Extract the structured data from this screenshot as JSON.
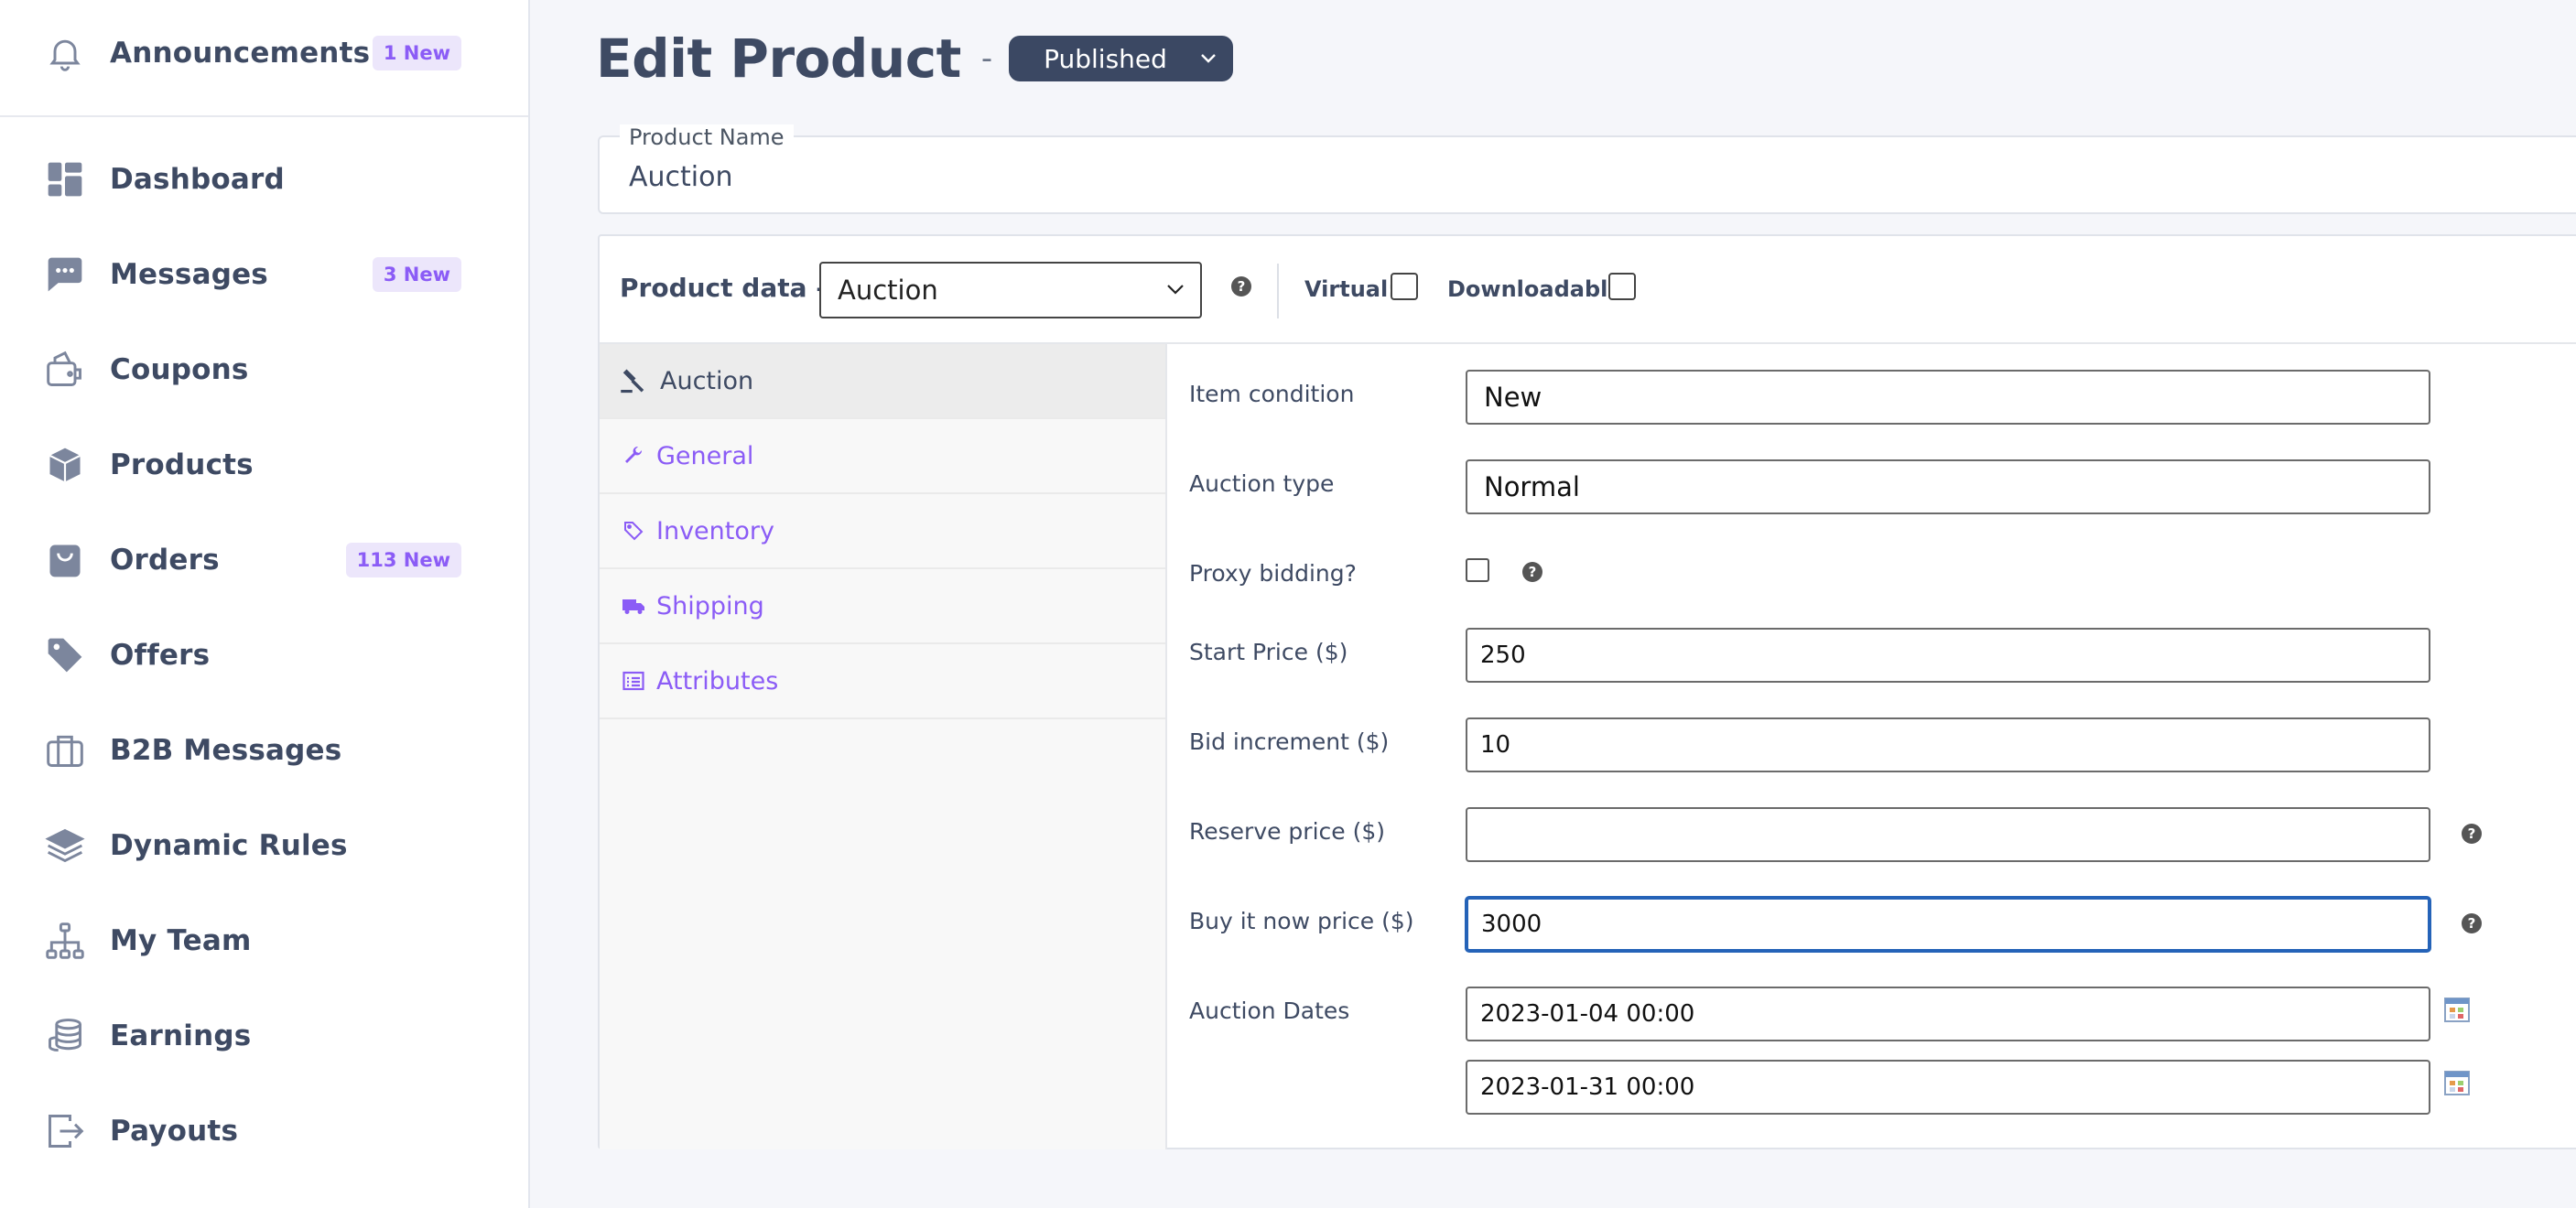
{
  "sidebar": {
    "items": [
      {
        "label": "Announcements",
        "badge": "1 New",
        "icon": "bell-icon"
      },
      {
        "label": "Dashboard",
        "badge": "",
        "icon": "dashboard-icon"
      },
      {
        "label": "Messages",
        "badge": "3 New",
        "icon": "chat-icon"
      },
      {
        "label": "Coupons",
        "badge": "",
        "icon": "coupon-icon"
      },
      {
        "label": "Products",
        "badge": "",
        "icon": "box-icon"
      },
      {
        "label": "Orders",
        "badge": "113 New",
        "icon": "bag-icon"
      },
      {
        "label": "Offers",
        "badge": "",
        "icon": "tag-icon"
      },
      {
        "label": "B2B Messages",
        "badge": "",
        "icon": "briefcase-icon"
      },
      {
        "label": "Dynamic Rules",
        "badge": "",
        "icon": "layers-icon"
      },
      {
        "label": "My Team",
        "badge": "",
        "icon": "org-chart-icon"
      },
      {
        "label": "Earnings",
        "badge": "",
        "icon": "coins-icon"
      },
      {
        "label": "Payouts",
        "badge": "",
        "icon": "logout-icon"
      }
    ]
  },
  "header": {
    "title": "Edit Product",
    "separator": "-",
    "status": "Published"
  },
  "product_name": {
    "legend": "Product Name",
    "value": "Auction"
  },
  "product_data": {
    "label": "Product data —",
    "type_selected": "Auction",
    "help": "?",
    "virtual_label": "Virtual:",
    "downloadable_label": "Downloadable:"
  },
  "tabs": [
    {
      "label": "Auction",
      "icon": "gavel-icon",
      "active": true
    },
    {
      "label": "General",
      "icon": "wrench-icon",
      "active": false
    },
    {
      "label": "Inventory",
      "icon": "tag-icon",
      "active": false
    },
    {
      "label": "Shipping",
      "icon": "truck-icon",
      "active": false
    },
    {
      "label": "Attributes",
      "icon": "list-icon",
      "active": false
    }
  ],
  "fields": {
    "item_condition": {
      "label": "Item condition",
      "value": "New"
    },
    "auction_type": {
      "label": "Auction type",
      "value": "Normal"
    },
    "proxy_bidding": {
      "label": "Proxy bidding?"
    },
    "start_price": {
      "label": "Start Price ($)",
      "value": "250"
    },
    "bid_increment": {
      "label": "Bid increment ($)",
      "value": "10"
    },
    "reserve_price": {
      "label": "Reserve price ($)",
      "value": ""
    },
    "buy_now_price": {
      "label": "Buy it now price ($)",
      "value": "3000"
    },
    "auction_dates": {
      "label": "Auction Dates",
      "start": "2023-01-04 00:00",
      "end": "2023-01-31 00:00"
    }
  },
  "colors": {
    "accent": "#8b5cf6",
    "sidebar_text": "#3e4a63",
    "icon": "#7c869d",
    "badge_bg": "#ece6fb",
    "status_bg": "#3b4863",
    "focus": "#2563b8"
  }
}
